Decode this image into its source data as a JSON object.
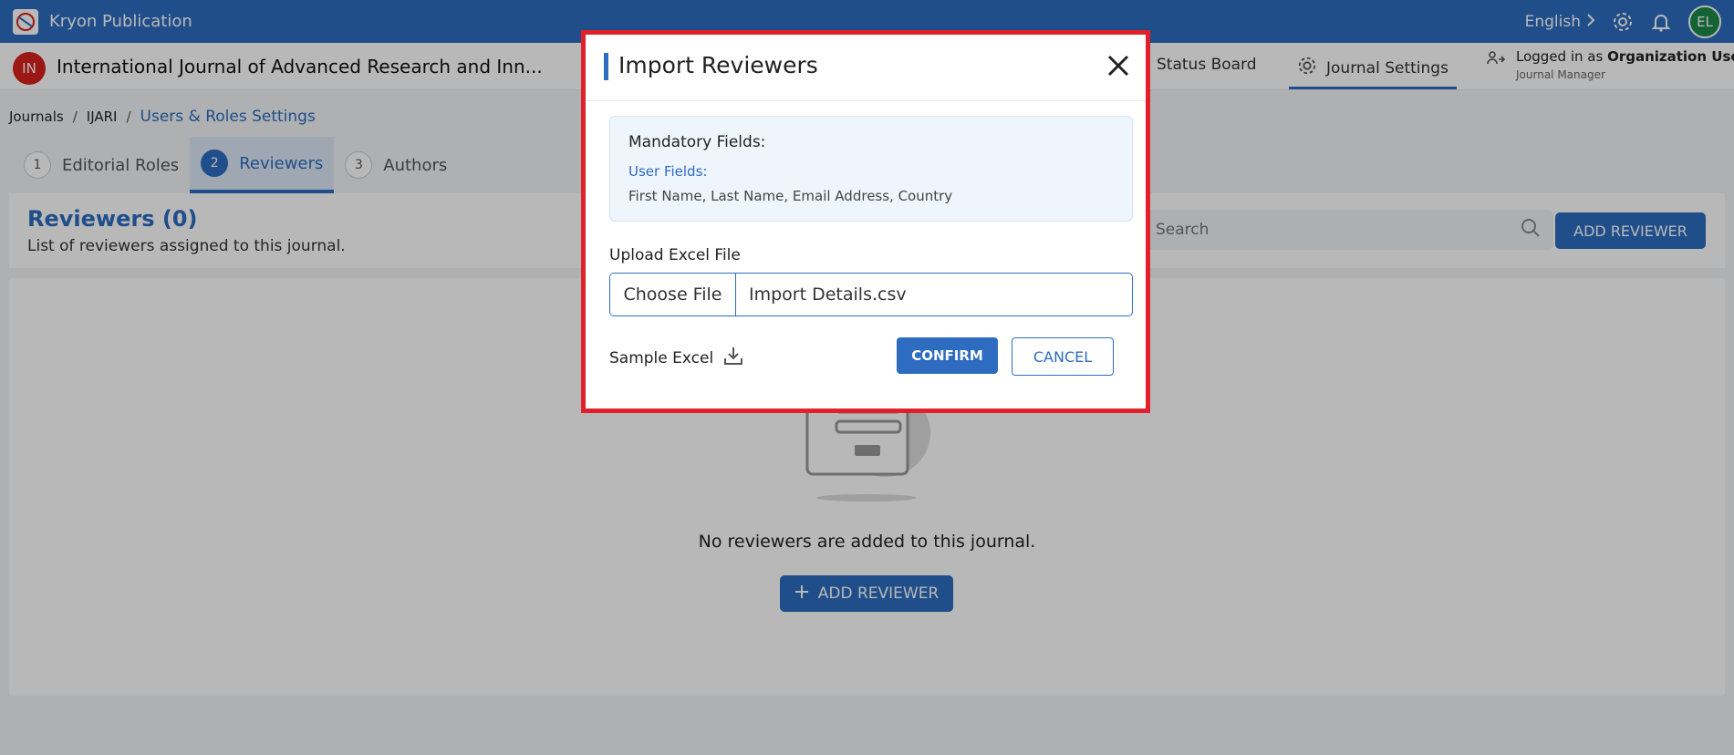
{
  "app": {
    "title": "Kryon Publication",
    "language": "English",
    "avatar_initials": "EL"
  },
  "journal": {
    "badge": "IN",
    "title": "International Journal of Advanced Research and Inn...",
    "nav": {
      "status_board": "Status Board",
      "journal_settings": "Journal Settings"
    },
    "login": {
      "prefix": "Logged in as",
      "user": "Organization User",
      "role": "Journal Manager"
    }
  },
  "breadcrumb": {
    "items": [
      "Journals",
      "IJARI",
      "Users & Roles Settings"
    ]
  },
  "tabs": [
    {
      "num": "1",
      "label": "Editorial Roles"
    },
    {
      "num": "2",
      "label": "Reviewers"
    },
    {
      "num": "3",
      "label": "Authors"
    }
  ],
  "section": {
    "title": "Reviewers (0)",
    "subtitle": "List of reviewers assigned to this journal.",
    "search_placeholder": "Search",
    "add_button": "ADD REVIEWER"
  },
  "empty": {
    "message": "No reviewers are added to this journal.",
    "add_button": "ADD REVIEWER"
  },
  "modal": {
    "title": "Import Reviewers",
    "mandatory_title": "Mandatory Fields:",
    "user_fields_label": "User Fields:",
    "user_fields_list": "First Name, Last Name, Email Address, Country",
    "upload_label": "Upload Excel File",
    "choose_file": "Choose File",
    "file_name": "Import Details.csv",
    "sample_excel": "Sample Excel",
    "confirm": "CONFIRM",
    "cancel": "CANCEL"
  },
  "colors": {
    "primary": "#2d6cc0",
    "highlight_border": "#e0202a",
    "avatar": "#1b8a4a",
    "journal_badge": "#d9221c"
  }
}
